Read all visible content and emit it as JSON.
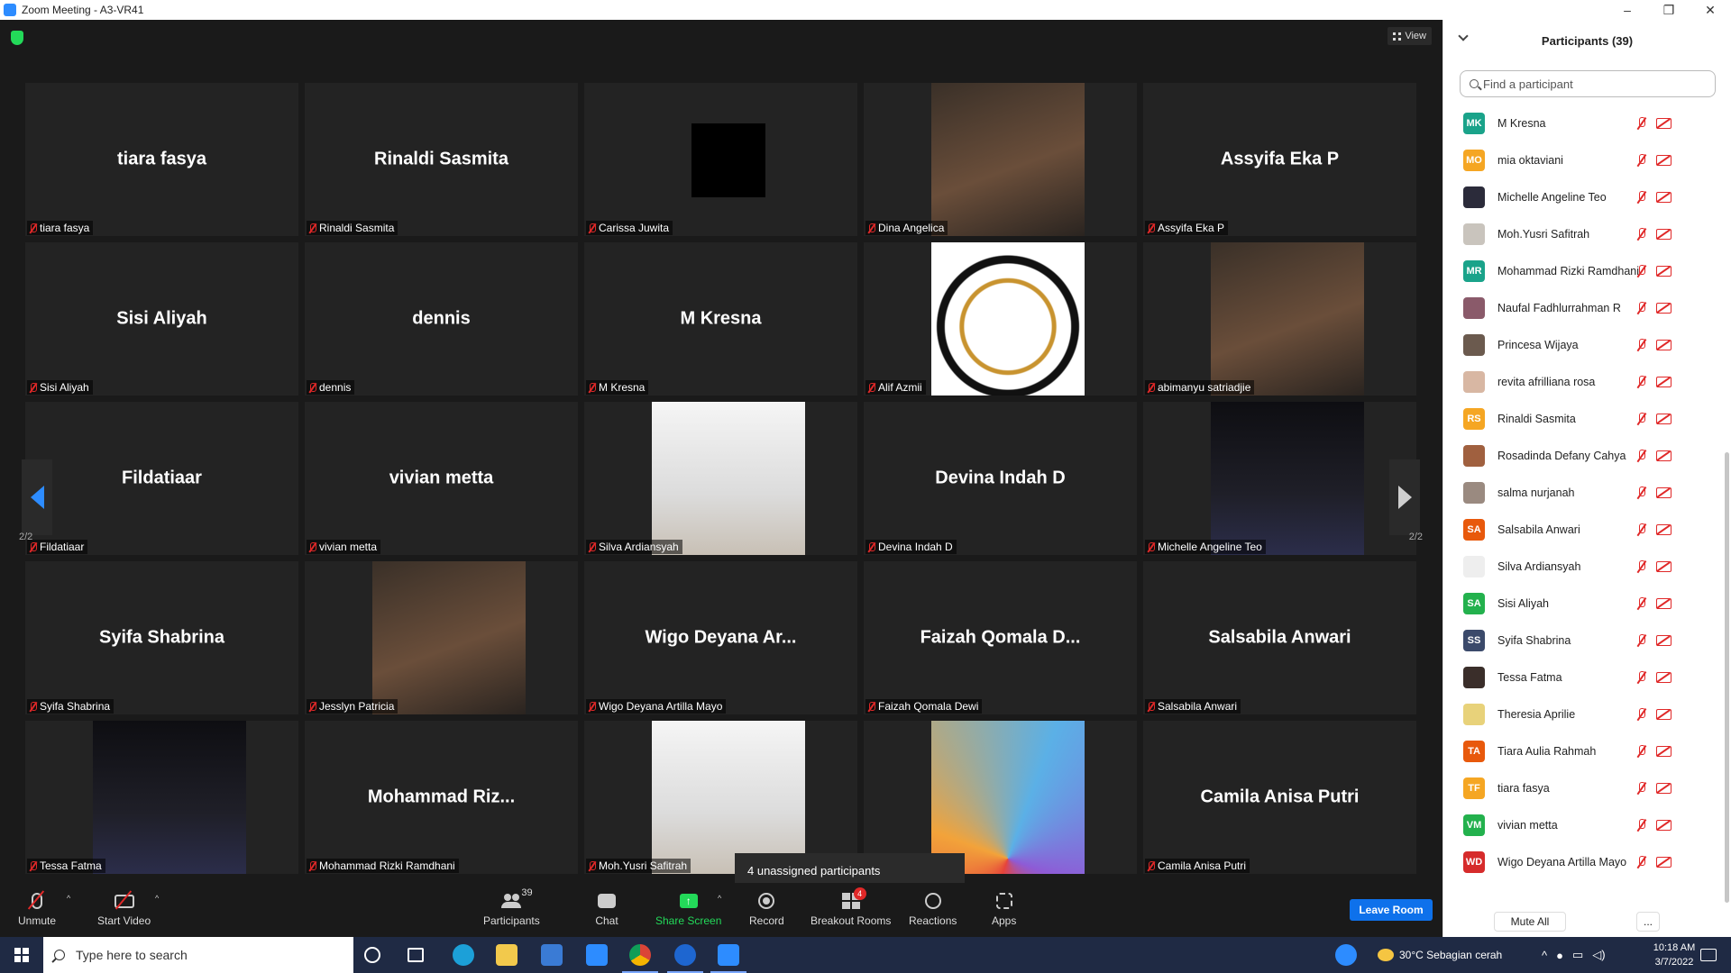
{
  "window": {
    "title": "Zoom Meeting - A3-VR41",
    "controls": [
      "–",
      "❐",
      "✕"
    ]
  },
  "meeting": {
    "view_label": "View",
    "page_left": "2/2",
    "page_right": "2/2",
    "unassigned_text": "4 unassigned participants",
    "tiles": [
      {
        "big": "tiara fasya",
        "label": "tiara fasya",
        "video": null
      },
      {
        "big": "Rinaldi Sasmita",
        "label": "Rinaldi Sasmita",
        "video": null
      },
      {
        "big": "",
        "label": "Carissa Juwita",
        "video": "black-square"
      },
      {
        "big": "",
        "label": "Dina Angelica",
        "video": "photo"
      },
      {
        "big": "Assyifa Eka P",
        "label": "Assyifa Eka P",
        "video": null
      },
      {
        "big": "Sisi Aliyah",
        "label": "Sisi Aliyah",
        "video": null
      },
      {
        "big": "dennis",
        "label": "dennis",
        "video": null
      },
      {
        "big": "M Kresna",
        "label": "M Kresna",
        "video": null
      },
      {
        "big": "",
        "label": "Alif Azmii",
        "video": "logo"
      },
      {
        "big": "",
        "label": "abimanyu satriadjie",
        "video": "photo"
      },
      {
        "big": "Fildatiaar",
        "label": "Fildatiaar",
        "video": null
      },
      {
        "big": "vivian metta",
        "label": "vivian metta",
        "video": null
      },
      {
        "big": "",
        "label": "Silva Ardiansyah",
        "video": "photo-light"
      },
      {
        "big": "Devina Indah D",
        "label": "Devina Indah D",
        "video": null
      },
      {
        "big": "",
        "label": "Michelle Angeline Teo",
        "video": "photo-dark"
      },
      {
        "big": "Syifa Shabrina",
        "label": "Syifa Shabrina",
        "video": null
      },
      {
        "big": "",
        "label": "Jesslyn Patricia",
        "video": "photo"
      },
      {
        "big": "Wigo Deyana Ar...",
        "label": "Wigo Deyana Artilla Mayo",
        "video": null
      },
      {
        "big": "Faizah Qomala D...",
        "label": "Faizah Qomala Dewi",
        "video": null
      },
      {
        "big": "Salsabila Anwari",
        "label": "Salsabila Anwari",
        "video": null
      },
      {
        "big": "",
        "label": "Tessa Fatma",
        "video": "photo-dark"
      },
      {
        "big": "Mohammad  Riz...",
        "label": "Mohammad Rizki Ramdhani",
        "video": null
      },
      {
        "big": "",
        "label": "Moh.Yusri Safitrah",
        "video": "photo-light"
      },
      {
        "big": "",
        "label": "ahman R",
        "video": "photo-color"
      },
      {
        "big": "Camila Anisa Putri",
        "label": "Camila Anisa Putri",
        "video": null
      }
    ]
  },
  "toolbar": {
    "unmute": "Unmute",
    "start_video": "Start Video",
    "participants": "Participants",
    "participants_count": "39",
    "chat": "Chat",
    "share_screen": "Share Screen",
    "record": "Record",
    "breakout_rooms": "Breakout Rooms",
    "breakout_badge": "4",
    "reactions": "Reactions",
    "apps": "Apps",
    "leave_room": "Leave Room"
  },
  "panel": {
    "title": "Participants (39)",
    "search_placeholder": "Find a participant",
    "participants": [
      {
        "initials": "MK",
        "name": "M Kresna",
        "color": "#1aa38a"
      },
      {
        "initials": "MO",
        "name": "mia oktaviani",
        "color": "#f5a623"
      },
      {
        "initials": "",
        "name": "Michelle Angeline Teo",
        "color": "#2b2b3a"
      },
      {
        "initials": "",
        "name": "Moh.Yusri Safitrah",
        "color": "#c9c4bd"
      },
      {
        "initials": "MR",
        "name": "Mohammad Rizki Ramdhani",
        "color": "#1aa38a"
      },
      {
        "initials": "",
        "name": "Naufal Fadhlurrahman R",
        "color": "#8a5a6a"
      },
      {
        "initials": "",
        "name": "Princesa Wijaya",
        "color": "#6b5a4e"
      },
      {
        "initials": "",
        "name": "revita afrilliana rosa",
        "color": "#d8b7a3"
      },
      {
        "initials": "RS",
        "name": "Rinaldi Sasmita",
        "color": "#f5a623"
      },
      {
        "initials": "",
        "name": "Rosadinda Defany Cahya",
        "color": "#a0603f"
      },
      {
        "initials": "",
        "name": "salma nurjanah",
        "color": "#9a8a80"
      },
      {
        "initials": "SA",
        "name": "Salsabila Anwari",
        "color": "#e8590c"
      },
      {
        "initials": "",
        "name": "Silva Ardiansyah",
        "color": "#eeeeee"
      },
      {
        "initials": "SA",
        "name": "Sisi Aliyah",
        "color": "#23b14d"
      },
      {
        "initials": "SS",
        "name": "Syifa Shabrina",
        "color": "#3b4a6b"
      },
      {
        "initials": "",
        "name": "Tessa Fatma",
        "color": "#3a2e2a"
      },
      {
        "initials": "",
        "name": "Theresia Aprilie",
        "color": "#e8d27a"
      },
      {
        "initials": "TA",
        "name": "Tiara Aulia Rahmah",
        "color": "#e8590c"
      },
      {
        "initials": "TF",
        "name": "tiara fasya",
        "color": "#f5a623"
      },
      {
        "initials": "VM",
        "name": "vivian metta",
        "color": "#23b14d"
      },
      {
        "initials": "WD",
        "name": "Wigo Deyana Artilla Mayo",
        "color": "#d62b2b"
      }
    ],
    "mute_all": "Mute All",
    "more": "..."
  },
  "taskbar": {
    "search_placeholder": "Type here to search",
    "weather": "30°C  Sebagian cerah",
    "time": "10:18 AM",
    "date": "3/7/2022"
  },
  "colors": {
    "accent": "#0e71eb",
    "share_green": "#23d959",
    "muted_red": "#e02828"
  }
}
